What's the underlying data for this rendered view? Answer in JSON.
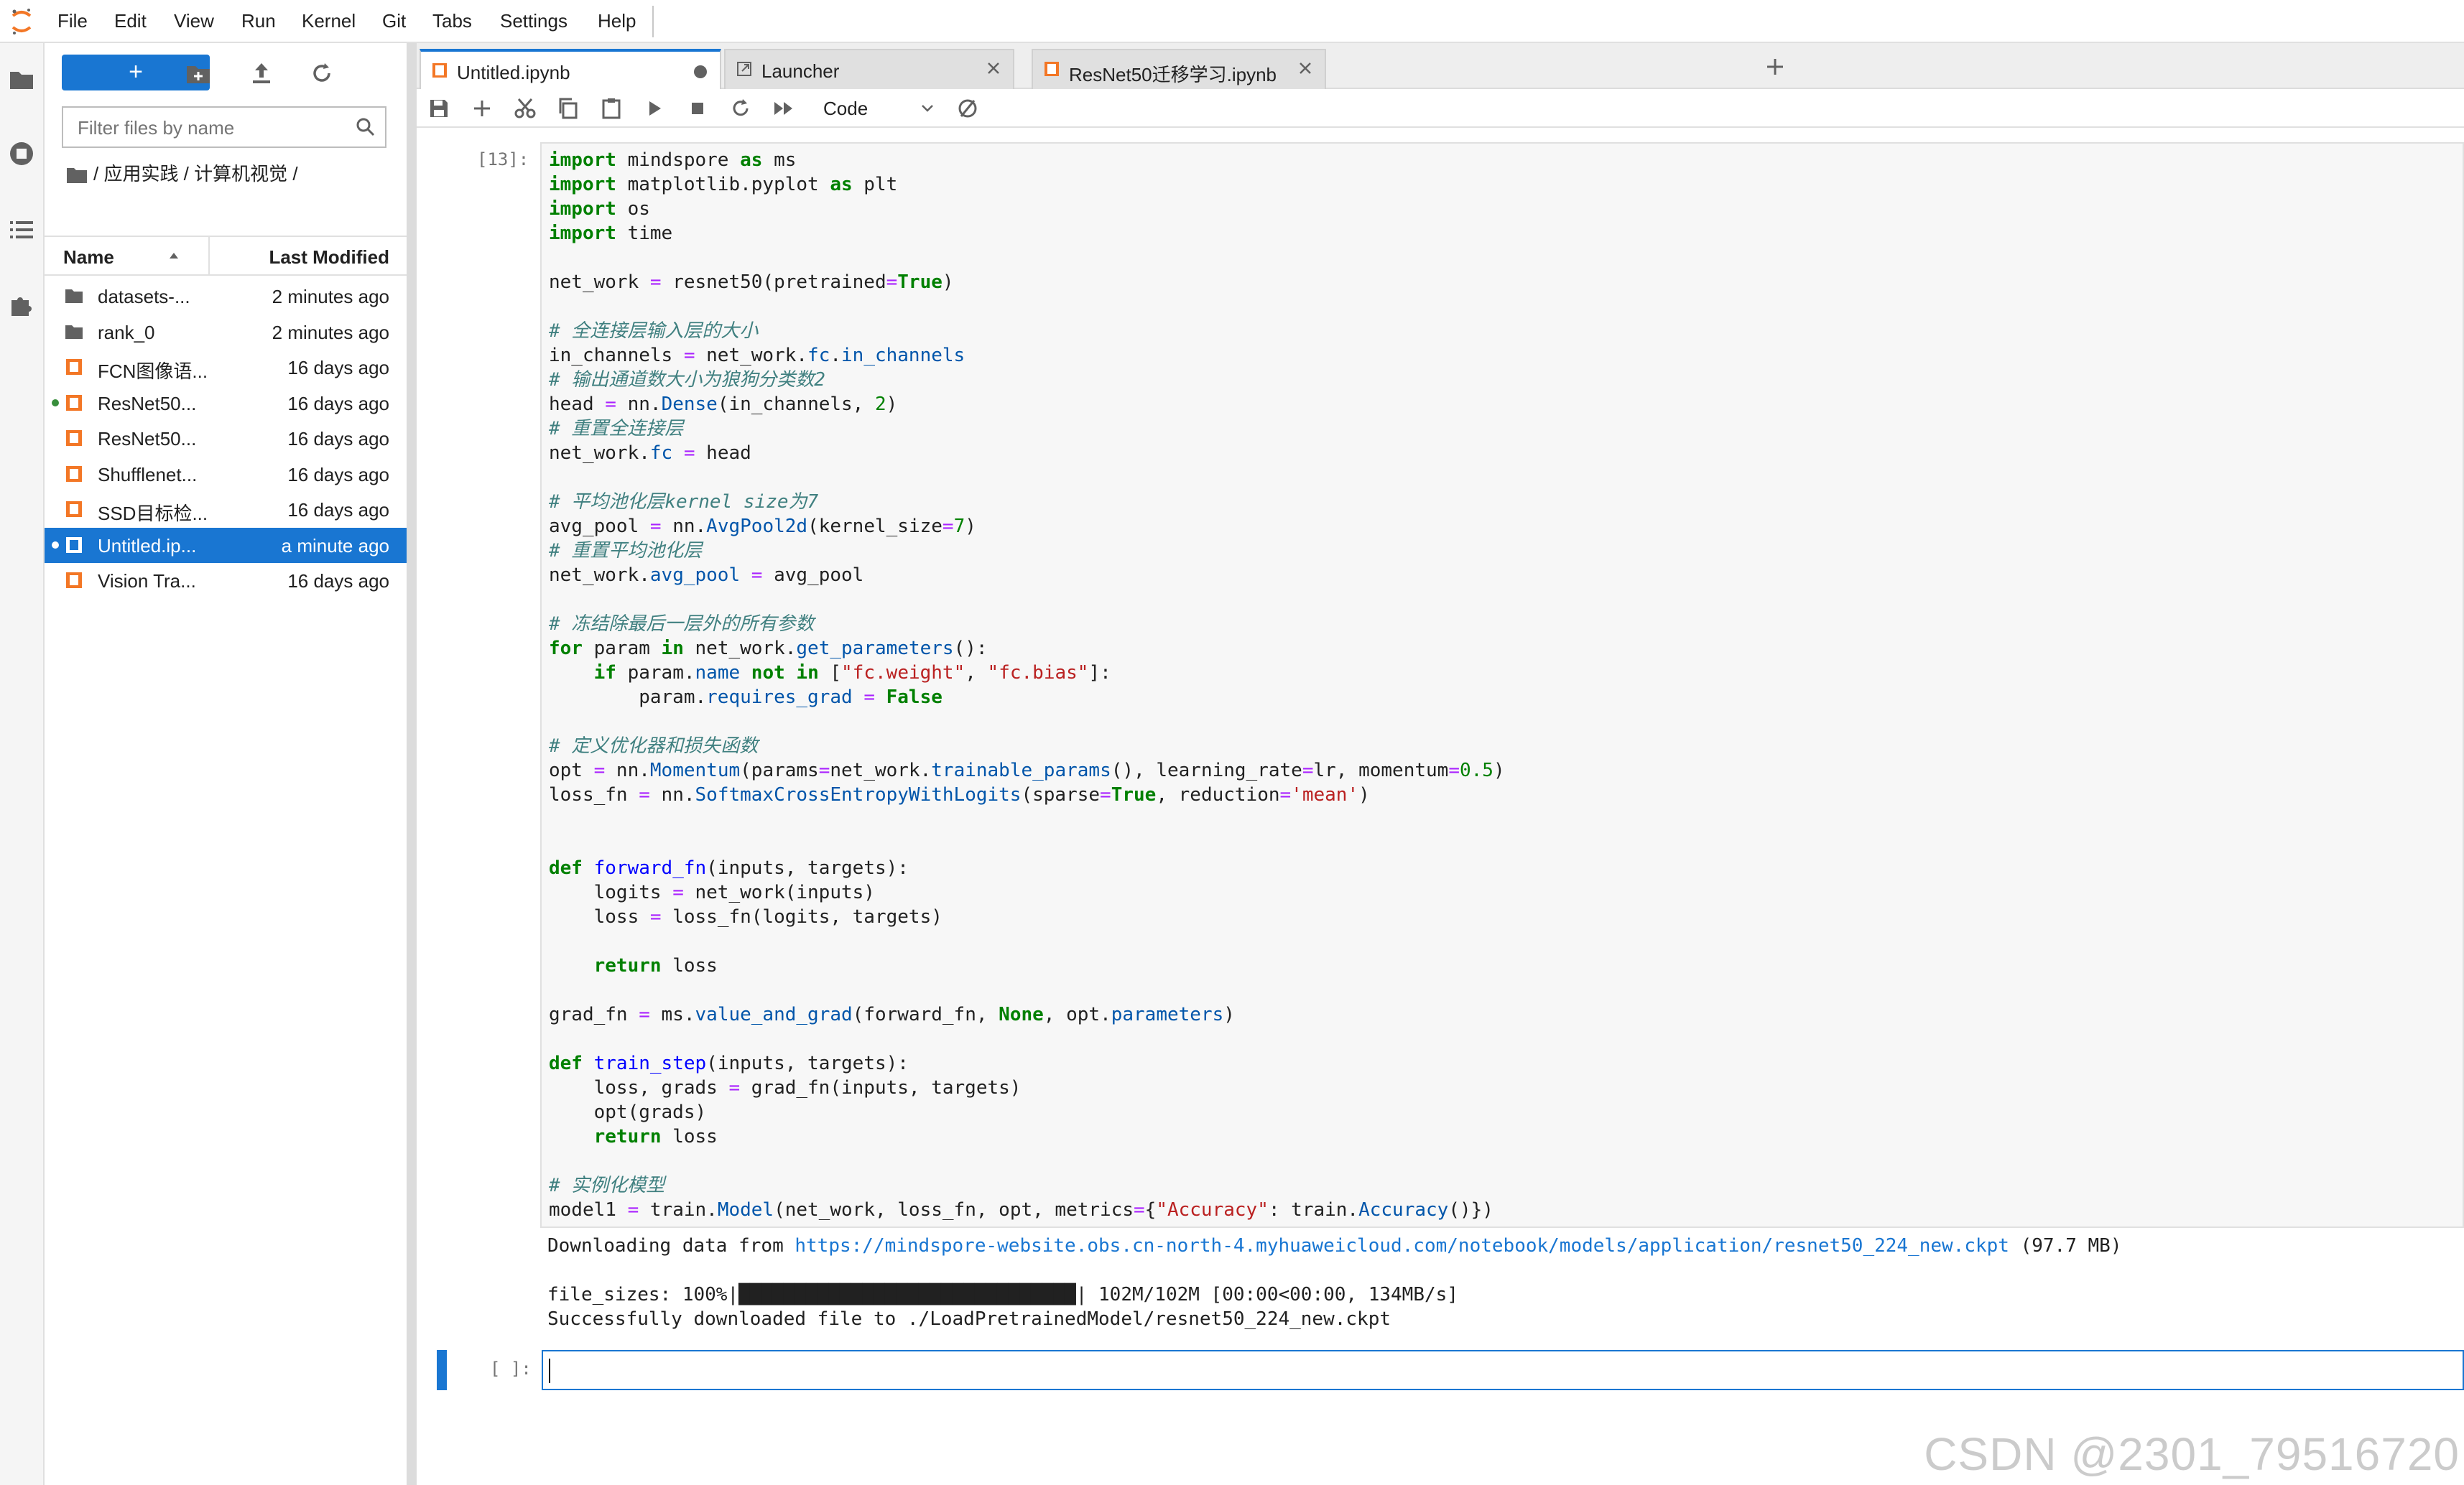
{
  "menubar": {
    "items": [
      "File",
      "Edit",
      "View",
      "Run",
      "Kernel",
      "Git",
      "Tabs",
      "Settings",
      "Help"
    ]
  },
  "filebrowser": {
    "new_label": "+",
    "filter_placeholder": "Filter files by name",
    "breadcrumb": "/ 应用实践 / 计算机视觉 /",
    "col_name": "Name",
    "col_modified": "Last Modified",
    "files": [
      {
        "name": "datasets-...",
        "modified": "2 minutes ago",
        "type": "folder"
      },
      {
        "name": "rank_0",
        "modified": "2 minutes ago",
        "type": "folder"
      },
      {
        "name": "FCN图像语...",
        "modified": "16 days ago",
        "type": "notebook"
      },
      {
        "name": "ResNet50...",
        "modified": "16 days ago",
        "type": "notebook",
        "running": true
      },
      {
        "name": "ResNet50...",
        "modified": "16 days ago",
        "type": "notebook"
      },
      {
        "name": "Shufflenet...",
        "modified": "16 days ago",
        "type": "notebook"
      },
      {
        "name": "SSD目标检...",
        "modified": "16 days ago",
        "type": "notebook"
      },
      {
        "name": "Untitled.ip...",
        "modified": "a minute ago",
        "type": "notebook",
        "running": true,
        "selected": true
      },
      {
        "name": "Vision Tra...",
        "modified": "16 days ago",
        "type": "notebook"
      }
    ]
  },
  "tabs": [
    {
      "label": "Untitled.ipynb",
      "active": true,
      "dirty": true
    },
    {
      "label": "Launcher",
      "active": false
    },
    {
      "label": "ResNet50迁移学习.ipynb",
      "active": false
    }
  ],
  "toolbar": {
    "cell_type": "Code"
  },
  "cells": {
    "cell1_prompt": "[13]:",
    "cell2_prompt": "[ ]:",
    "output_prefix": "Downloading data from ",
    "output_url": "https://mindspore-website.obs.cn-north-4.myhuaweicloud.com/notebook/models/application/resnet50_224_new.ckpt",
    "output_size": " (97.7 MB)",
    "output_progress_prefix": "file_sizes: 100%|",
    "output_progress_bar": "██████████████████████████████",
    "output_progress_suffix": "| 102M/102M [00:00<00:00, 134MB/s]",
    "output_success": "Successfully downloaded file to ./LoadPretrainedModel/resnet50_224_new.ckpt"
  },
  "watermark": "CSDN @2301_79516720",
  "colors": {
    "accent": "#1976d2",
    "notebook_icon": "#f37726",
    "running_dot": "#388e3c"
  }
}
